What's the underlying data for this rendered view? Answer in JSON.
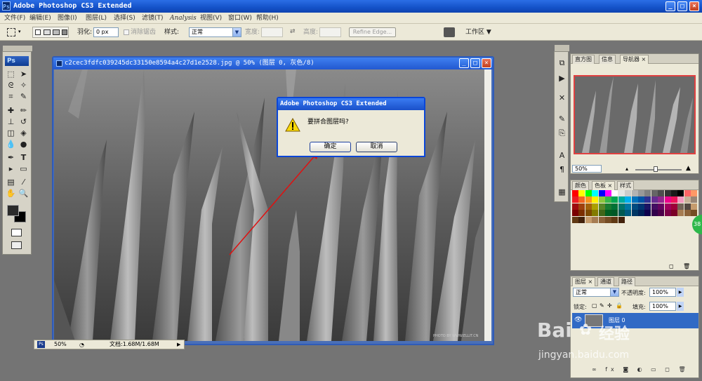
{
  "window": {
    "title": "Adobe Photoshop CS3 Extended",
    "logo": "Ps",
    "controls": [
      "_",
      "□",
      "×"
    ]
  },
  "menubar": {
    "items": [
      "文件(F)",
      "编辑(E)",
      "图像(I)",
      "图层(L)",
      "选择(S)",
      "滤镜(T)",
      "Analysis",
      "视图(V)",
      "窗口(W)",
      "帮助(H)"
    ]
  },
  "options_bar": {
    "feather_label": "羽化:",
    "feather_value": "0 px",
    "antialias_label": "消除锯齿",
    "style_label": "样式:",
    "style_value": "正常",
    "width_label": "宽度:",
    "height_label": "高度:",
    "refine_edge": "Refine Edge...",
    "workspace_label": "工作区 ▼"
  },
  "document": {
    "title": "c2cec3fdfc039245dc33150e8594a4c27d1e2528.jpg @ 50% (图层 0, 灰色/8)",
    "zoom": "50%",
    "doc_size": "文档:1.68M/1.68M",
    "photo_credit": "PHOTO BY WWW.ELLIT.CN"
  },
  "dialog": {
    "title": "Adobe Photoshop CS3 Extended",
    "message": "要拼合图层吗?",
    "ok": "确定",
    "cancel": "取消"
  },
  "navigator_panel": {
    "tabs": [
      "直方图",
      "信息",
      "导航器 ×"
    ],
    "zoom": "50%"
  },
  "swatches_panel": {
    "tabs": [
      "颜色",
      "色板 ×",
      "样式"
    ],
    "colors": [
      "#ff0000",
      "#ffff00",
      "#00ff00",
      "#00ffff",
      "#0000ff",
      "#ff00ff",
      "#ffffff",
      "#e6e6e6",
      "#cccccc",
      "#b3b3b3",
      "#999999",
      "#808080",
      "#666666",
      "#4d4d4d",
      "#333333",
      "#1a1a1a",
      "#000000",
      "#ff6666",
      "#ff9966",
      "#ed1c24",
      "#f26522",
      "#f7941d",
      "#fff200",
      "#8dc63f",
      "#39b54a",
      "#00a651",
      "#00a99d",
      "#00aeef",
      "#0072bc",
      "#0054a6",
      "#2e3192",
      "#662d91",
      "#92278f",
      "#ec008c",
      "#ed145b",
      "#f49ac1",
      "#c7b299",
      "#998675",
      "#9e0b0f",
      "#a0410d",
      "#a3620a",
      "#aba000",
      "#598527",
      "#1a7b30",
      "#007236",
      "#00746b",
      "#0076a3",
      "#004b80",
      "#003471",
      "#1b1464",
      "#440e62",
      "#630460",
      "#9e005d",
      "#9e0039",
      "#736357",
      "#534741",
      "#c69c6d",
      "#790000",
      "#7b2e00",
      "#7d4900",
      "#827b00",
      "#406618",
      "#005e20",
      "#005826",
      "#005952",
      "#005b7f",
      "#003663",
      "#002157",
      "#0d004c",
      "#32004b",
      "#4b0049",
      "#7b0046",
      "#7a0026",
      "#a67c52",
      "#8c6239",
      "#754c24",
      "#603913",
      "#42210b",
      "#c69c6d",
      "#a67c52",
      "#8c6239",
      "#754c24",
      "#603913",
      "#42210b"
    ]
  },
  "layers_panel": {
    "tabs": [
      "图层 ×",
      "通道",
      "路径"
    ],
    "blend_mode": "正常",
    "opacity_label": "不透明度:",
    "opacity_value": "100%",
    "lock_label": "锁定:",
    "fill_label": "填充:",
    "fill_value": "100%",
    "layer_name": "图层 0"
  },
  "watermark": {
    "brand": "Bai",
    "brand2": "经验",
    "url": "jingyan.baidu.com"
  },
  "side_badge": "38"
}
